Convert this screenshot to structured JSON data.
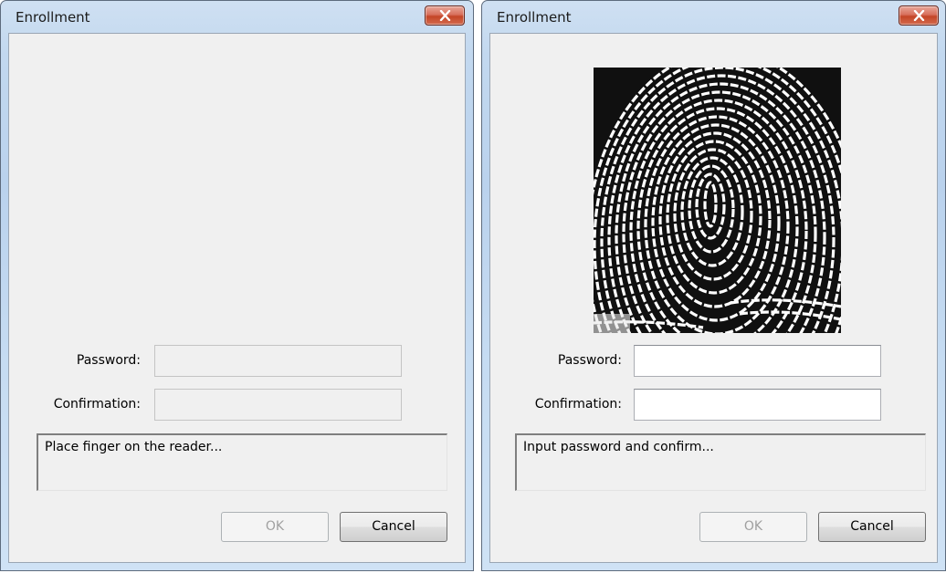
{
  "left_dialog": {
    "title": "Enrollment",
    "password_label": "Password:",
    "password_value": "",
    "confirmation_label": "Confirmation:",
    "confirmation_value": "",
    "status_text": "Place finger on the reader...",
    "ok_label": "OK",
    "cancel_label": "Cancel"
  },
  "right_dialog": {
    "title": "Enrollment",
    "password_label": "Password:",
    "password_value": "",
    "confirmation_label": "Confirmation:",
    "confirmation_value": "",
    "status_text": "Input password and confirm...",
    "ok_label": "OK",
    "cancel_label": "Cancel"
  },
  "icons": {
    "close": "close-x-icon",
    "fingerprint": "fingerprint-image"
  },
  "colors": {
    "close_button": "#c44526",
    "dialog_body": "#f0f0f0",
    "frame": "#bad2ed"
  }
}
